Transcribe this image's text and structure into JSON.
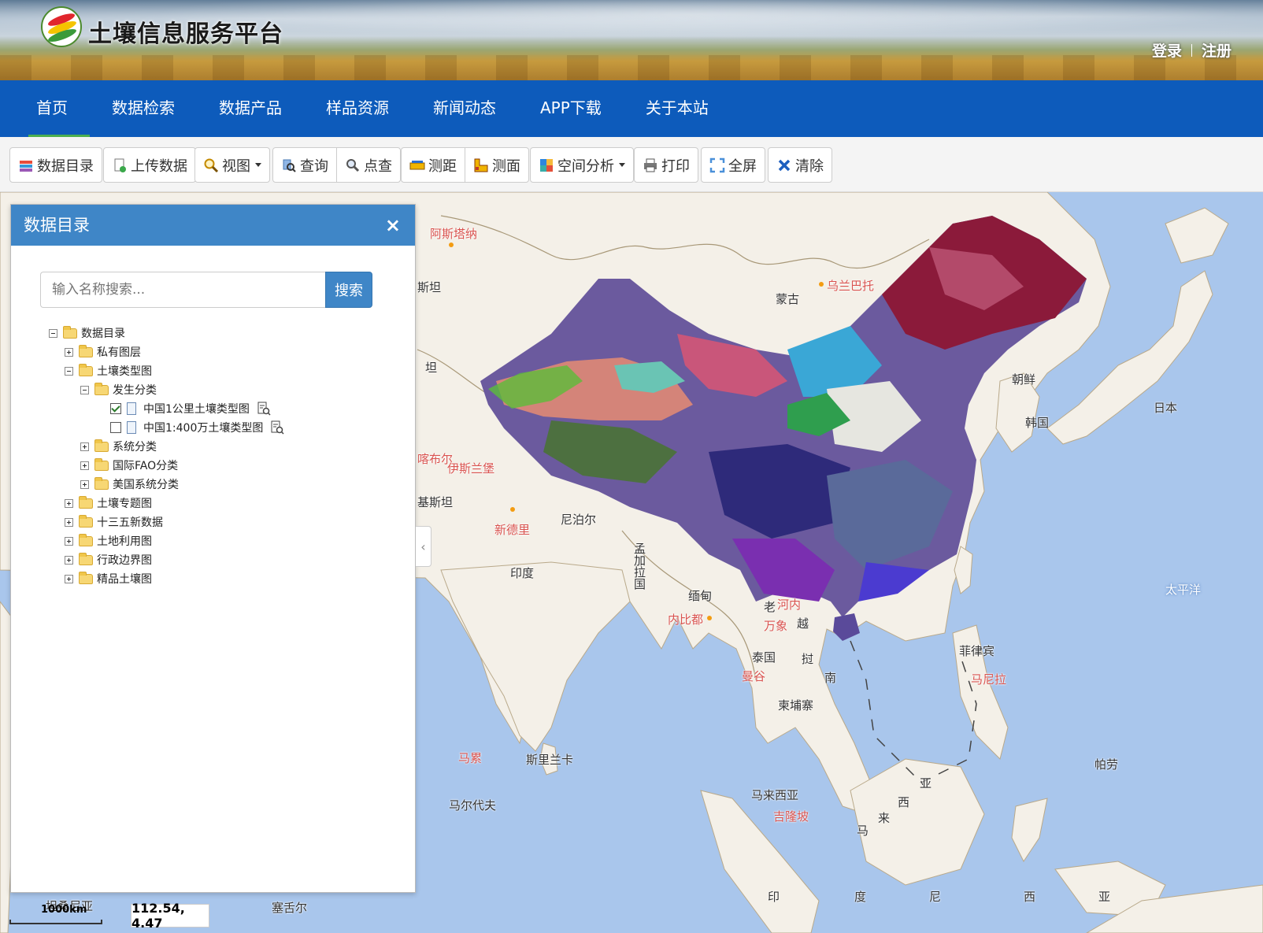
{
  "header": {
    "site_title": "土壤信息服务平台",
    "login": "登录",
    "register": "注册"
  },
  "nav": {
    "items": [
      {
        "label": "首页",
        "active": true
      },
      {
        "label": "数据检索"
      },
      {
        "label": "数据产品"
      },
      {
        "label": "样品资源"
      },
      {
        "label": "新闻动态"
      },
      {
        "label": "APP下载"
      },
      {
        "label": "关于本站"
      }
    ]
  },
  "toolbar": {
    "catalog": "数据目录",
    "upload": "上传数据",
    "view": "视图",
    "query": "查询",
    "point_query": "点查",
    "measure_distance": "测距",
    "measure_area": "测面",
    "spatial_analysis": "空间分析",
    "print": "打印",
    "fullscreen": "全屏",
    "clear": "清除"
  },
  "panel": {
    "title": "数据目录",
    "close": "×",
    "search_placeholder": "输入名称搜索...",
    "search_button": "搜索",
    "tree": {
      "root": "数据目录",
      "private_layers": "私有图层",
      "soil_type_maps": "土壤类型图",
      "genetic_classification": "发生分类",
      "layer_1km": "中国1公里土壤类型图",
      "layer_1km_checked": true,
      "layer_4m": "中国1:400万土壤类型图",
      "layer_4m_checked": false,
      "system_classification": "系统分类",
      "fao_classification": "国际FAO分类",
      "us_classification": "美国系统分类",
      "soil_thematic": "土壤专题图",
      "new_data_135": "十三五新数据",
      "land_use": "土地利用图",
      "admin_boundary": "行政边界图",
      "fine_soil": "精品土壤图"
    }
  },
  "map": {
    "labels": {
      "astana": "阿斯塔纳",
      "ulaanbaatar": "乌兰巴托",
      "mongolia": "蒙古",
      "north_korea": "朝鲜",
      "south_korea": "韩国",
      "japan": "日本",
      "kabul": "喀布尔",
      "islamabad": "伊斯兰堡",
      "new_delhi": "新德里",
      "nepal": "尼泊尔",
      "bangladesh": "孟加拉国",
      "india": "印度",
      "myanmar": "缅甸",
      "naypyidaw": "内比都",
      "laos": "老",
      "hanoi": "河内",
      "vientiane": "万象",
      "viet": "越",
      "thailand": "泰国",
      "bangkok": "曼谷",
      "cambodia": "柬埔寨",
      "cambodia_nan": "南",
      "pacific": "太平洋",
      "philippines": "菲律宾",
      "manila": "马尼拉",
      "sri_lanka": "斯里兰卡",
      "male": "马累",
      "maldives": "马尔代夫",
      "malaysia": "马来西亚",
      "kuala_lumpur": "吉隆坡",
      "palau": "帕劳",
      "indonesia_1": "印",
      "indonesia_2": "度",
      "indonesia_3": "尼",
      "indonesia_4": "西",
      "indonesia_5": "亚",
      "seychelles": "塞舌尔",
      "tanzania": "坦桑尼亚",
      "malay_1": "马",
      "malay_2": "来",
      "malay_3": "西",
      "malay_4": "亚",
      "kazakh_tan": "斯坦",
      "tan2": "坦",
      "pakistan": "基斯坦",
      "cambodia_2": "挝"
    },
    "scale_label": "1000km",
    "coords": "112.54, 4.47"
  }
}
